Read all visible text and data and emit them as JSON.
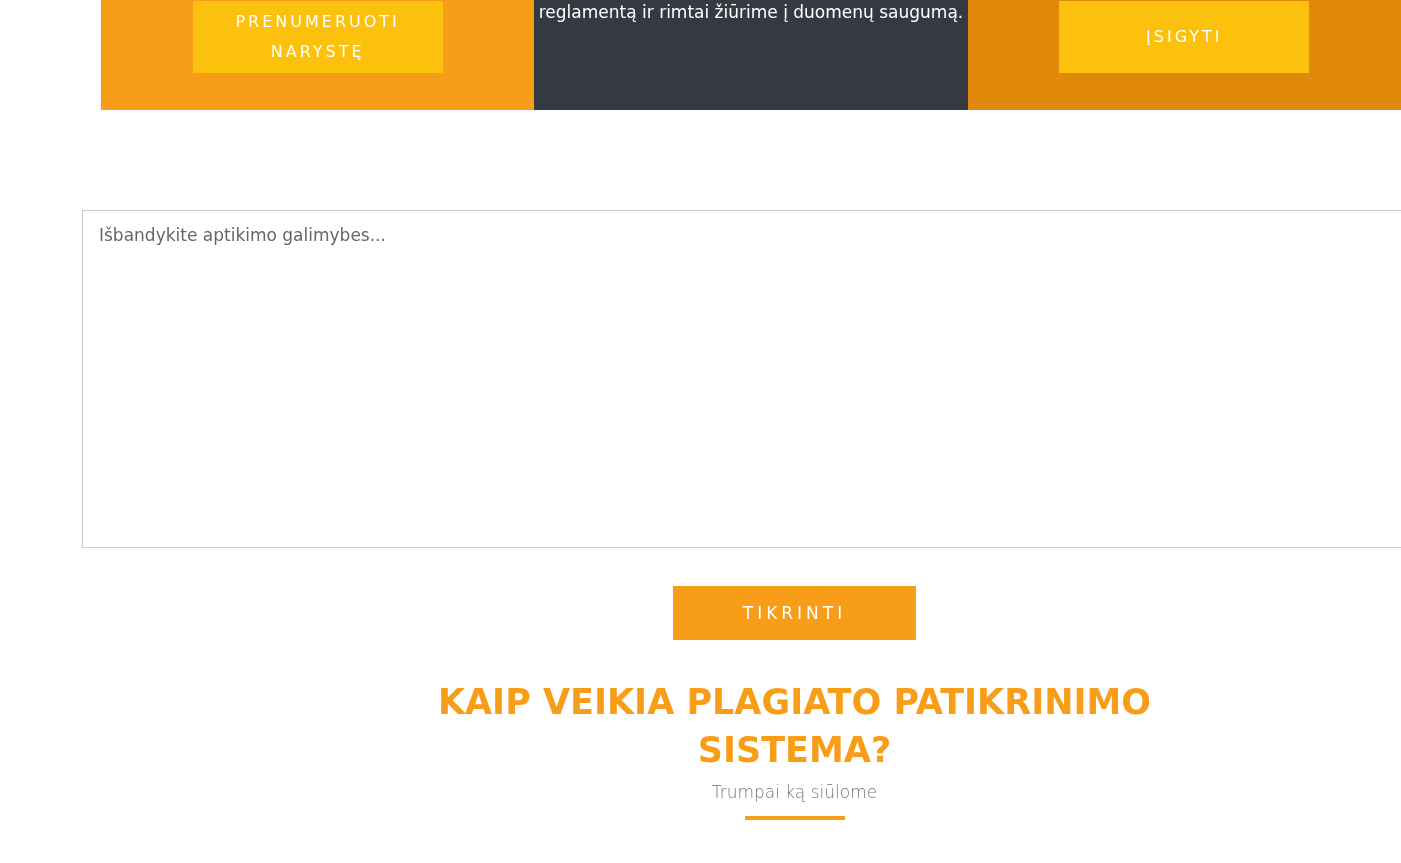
{
  "panels": [
    {
      "kind": "button",
      "color": "#f89d17",
      "button": "PRENUMERUOTI NARYSTĘ"
    },
    {
      "kind": "text",
      "color": "#353a42",
      "text": "reglamentą ir rimtai žiūrime į duomenų saugumą."
    },
    {
      "kind": "button",
      "color": "#e0890a",
      "button": "ĮSIGYTI"
    }
  ],
  "checker": {
    "placeholder": "Išbandykite aptikimo galimybes...",
    "button": "TIKRINTI"
  },
  "section": {
    "title": "KAIP VEIKIA PLAGIATO PATIKRINIMO SISTEMA?",
    "subtitle": "Trumpai ką siūlome"
  }
}
